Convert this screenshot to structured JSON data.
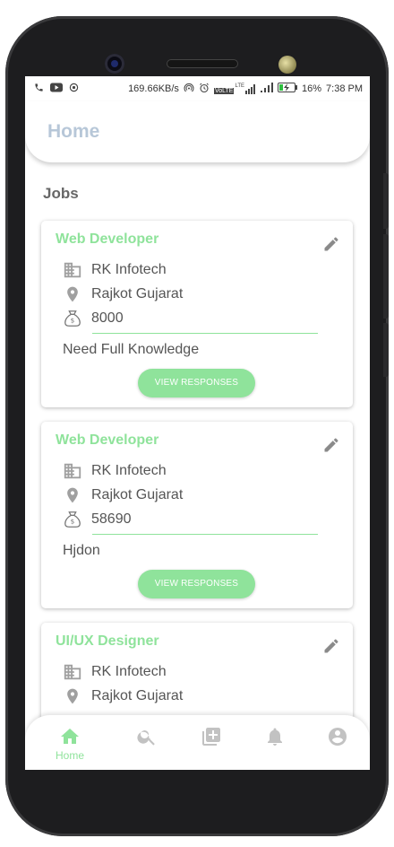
{
  "statusbar": {
    "network_speed": "169.66KB/s",
    "lte": "LTE",
    "battery": "16%",
    "time": "7:38 PM"
  },
  "appbar": {
    "title": "Home"
  },
  "section": {
    "title": "Jobs"
  },
  "jobs": [
    {
      "title": "Web Developer",
      "company": "RK Infotech",
      "location": "Rajkot Gujarat",
      "salary": "8000",
      "description": "Need Full Knowledge",
      "button": "VIEW RESPONSES"
    },
    {
      "title": "Web Developer",
      "company": "RK Infotech",
      "location": "Rajkot Gujarat",
      "salary": "58690",
      "description": "Hjdon",
      "button": "VIEW RESPONSES"
    },
    {
      "title": "UI/UX Designer",
      "company": "RK Infotech",
      "location": "Rajkot Gujarat"
    }
  ],
  "bottomnav": {
    "items": [
      {
        "label": "Home",
        "icon": "home-icon",
        "active": true
      },
      {
        "icon": "search-icon"
      },
      {
        "icon": "add-post-icon"
      },
      {
        "icon": "notification-bell-icon"
      },
      {
        "icon": "account-circle-icon"
      }
    ]
  },
  "colors": {
    "accent": "#8fe39b",
    "title": "#b7c7d8",
    "icon": "#c2c2c2"
  }
}
